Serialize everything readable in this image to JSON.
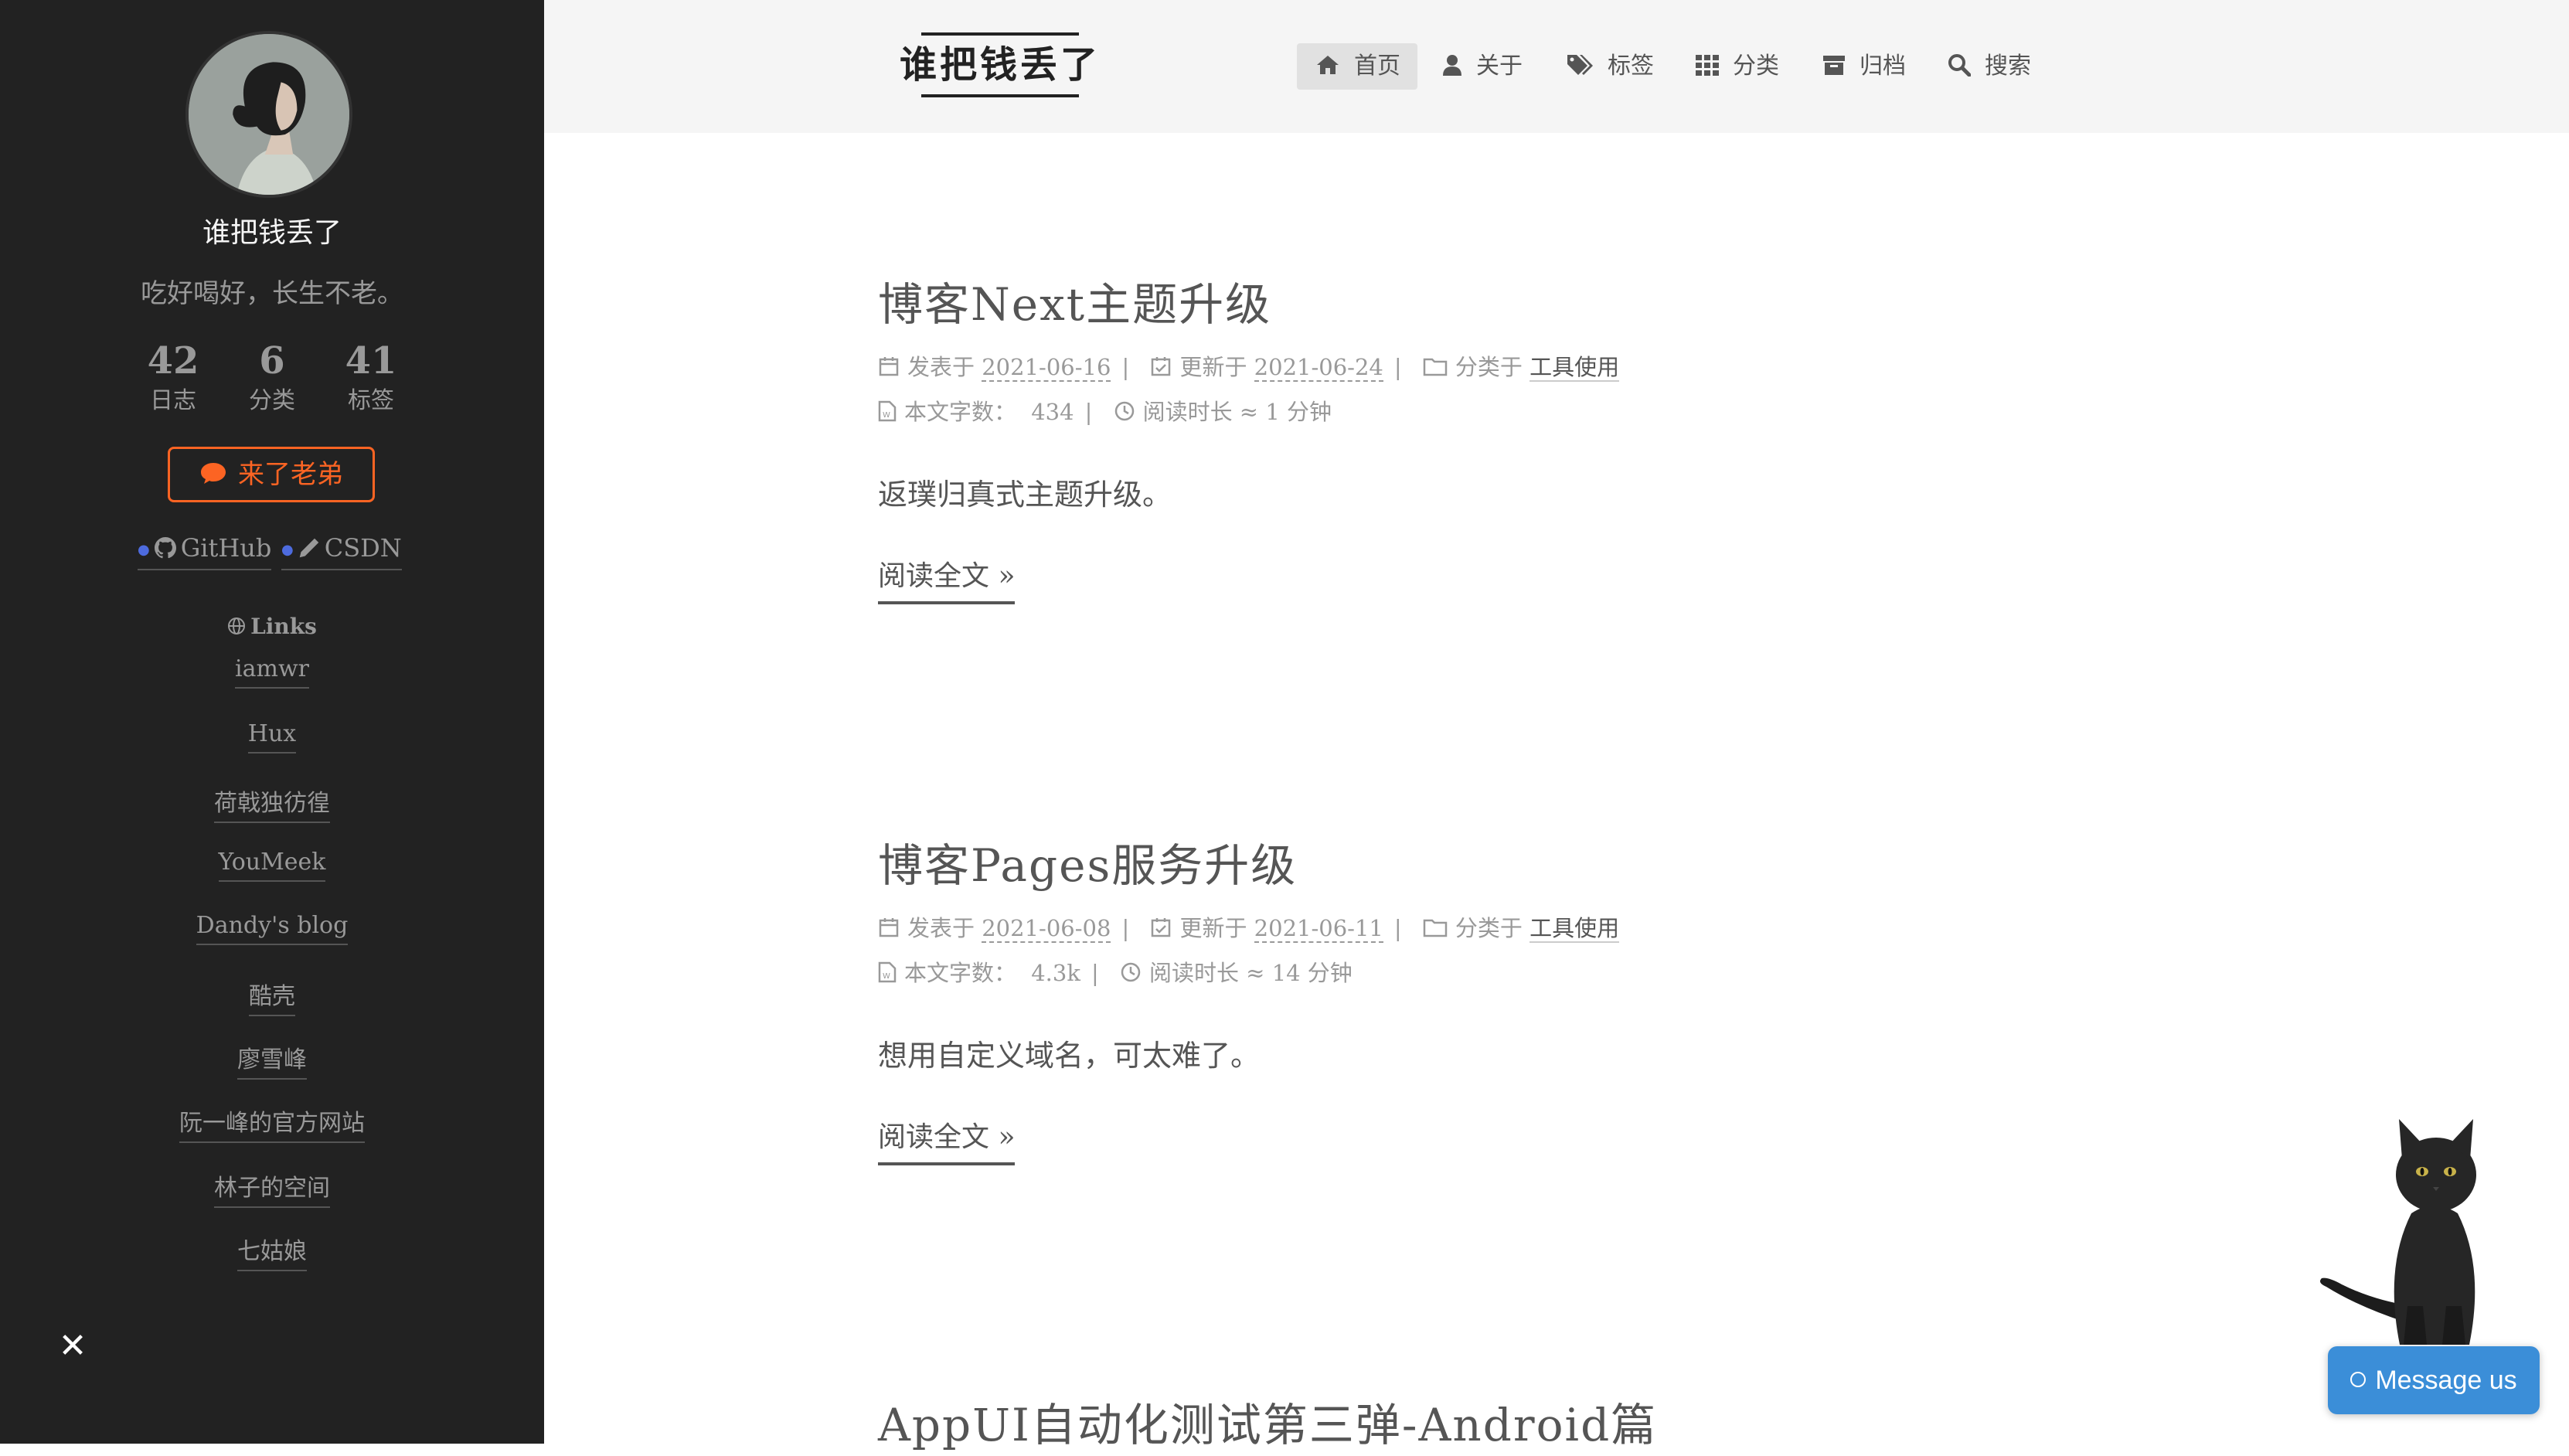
{
  "sidebar": {
    "author": "谁把钱丢了",
    "description": "吃好喝好，长生不老。",
    "stats": [
      {
        "count": "42",
        "label": "日志"
      },
      {
        "count": "6",
        "label": "分类"
      },
      {
        "count": "41",
        "label": "标签"
      }
    ],
    "chat_label": "来了老弟",
    "social": [
      {
        "label": "GitHub",
        "icon": "github-icon"
      },
      {
        "label": "CSDN",
        "icon": "pencil-icon"
      }
    ],
    "links_title": "Links",
    "links": [
      "iamwr",
      "Hux",
      "荷戟独彷徨",
      "YouMeek",
      "Dandy's blog",
      "酷壳",
      "廖雪峰",
      "阮一峰的官方网站",
      "林子的空间",
      "七姑娘"
    ],
    "close": "✕"
  },
  "header": {
    "brand": "谁把钱丢了",
    "nav": [
      {
        "label": "首页",
        "icon": "home-icon",
        "active": true
      },
      {
        "label": "关于",
        "icon": "user-icon"
      },
      {
        "label": "标签",
        "icon": "tags-icon"
      },
      {
        "label": "分类",
        "icon": "grid-icon"
      },
      {
        "label": "归档",
        "icon": "archive-icon"
      },
      {
        "label": "搜索",
        "icon": "search-icon"
      }
    ]
  },
  "posts": [
    {
      "title": "博客Next主题升级",
      "posted_label": "发表于",
      "posted": "2021-06-16",
      "updated_label": "更新于",
      "updated": "2021-06-24",
      "category_label": "分类于",
      "category": "工具使用",
      "words_label": "本文字数：",
      "words": "434",
      "read_label": "阅读时长 ≈",
      "read": "1 分钟",
      "excerpt": "返璞归真式主题升级。",
      "readmore": "阅读全文 »"
    },
    {
      "title": "博客Pages服务升级",
      "posted_label": "发表于",
      "posted": "2021-06-08",
      "updated_label": "更新于",
      "updated": "2021-06-11",
      "category_label": "分类于",
      "category": "工具使用",
      "words_label": "本文字数：",
      "words": "4.3k",
      "read_label": "阅读时长 ≈",
      "read": "14 分钟",
      "excerpt": "想用自定义域名，可太难了。",
      "readmore": "阅读全文 »"
    },
    {
      "title": "AppUI自动化测试第三弹-Android篇"
    }
  ],
  "widget": {
    "message_label": "Message us"
  },
  "colors": {
    "sidebar_bg": "#222222",
    "accent": "#fc6423",
    "header_bg": "#f5f5f5",
    "message_bg": "#3b8ed8"
  }
}
